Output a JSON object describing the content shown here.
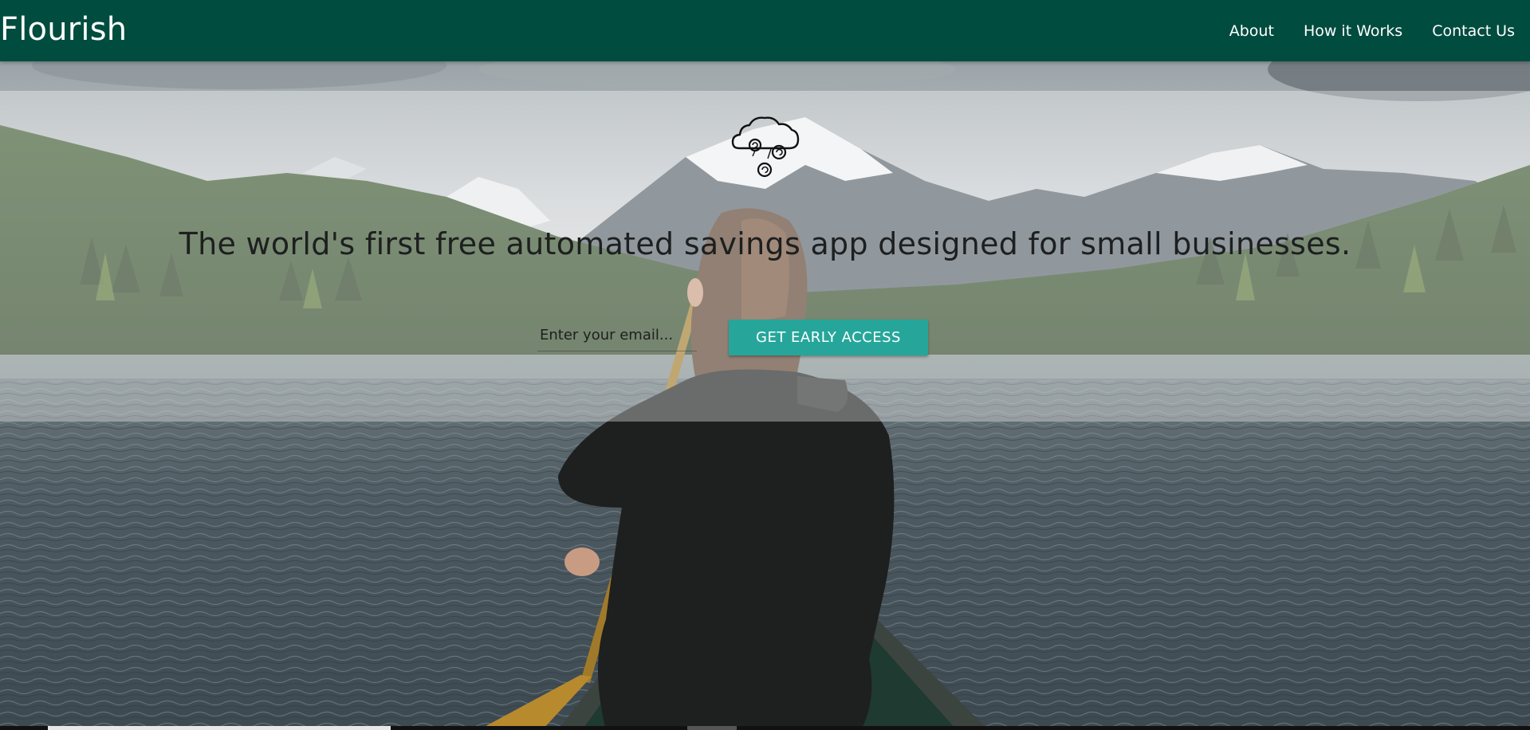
{
  "navbar": {
    "brand": "Flourish",
    "links": [
      {
        "label": "About"
      },
      {
        "label": "How it Works"
      },
      {
        "label": "Contact Us"
      }
    ],
    "background": "#004c3f"
  },
  "hero": {
    "icon": "cloud-rain-coins-icon",
    "headline": "The world's first free automated savings app designed for small businesses.",
    "email_placeholder": "Enter your email...",
    "email_value": "",
    "cta_label": "GET EARLY ACCESS",
    "cta_color": "#26a69a"
  }
}
